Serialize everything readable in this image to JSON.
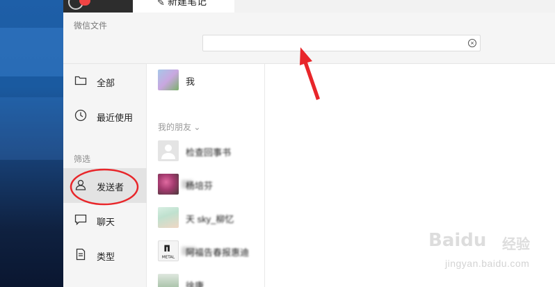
{
  "topbar": {
    "chat_badge": "",
    "note_tab_label": "新建笔记"
  },
  "window": {
    "title": "微信文件",
    "search_value": "",
    "search_placeholder": ""
  },
  "nav": {
    "all_label": "全部",
    "recent_label": "最近使用",
    "filter_section": "筛选",
    "sender_label": "发送者",
    "chat_label": "聊天",
    "type_label": "类型"
  },
  "contacts": {
    "me_label": "我",
    "group_header": "我的朋友 ⌄",
    "items": [
      {
        "name": "检查回事书"
      },
      {
        "name": "杨培芬"
      },
      {
        "name": "天 sky_柳忆"
      },
      {
        "name": "阿福告春报惠迪"
      },
      {
        "name": "徐康"
      }
    ]
  },
  "watermark": {
    "brand": "Baidu",
    "brand_cn": "经验",
    "url": "jingyan.baidu.com"
  },
  "colors": {
    "annotation_red": "#e8262a",
    "window_bg": "#f5f5f5",
    "active_nav_bg": "#e3e3e3"
  },
  "icons": {
    "folder": "folder-icon",
    "clock": "clock-icon",
    "person": "person-icon",
    "chat": "chat-bubble-icon",
    "doc": "document-icon",
    "clear": "clear-circle-icon",
    "pencil": "pencil-icon"
  }
}
